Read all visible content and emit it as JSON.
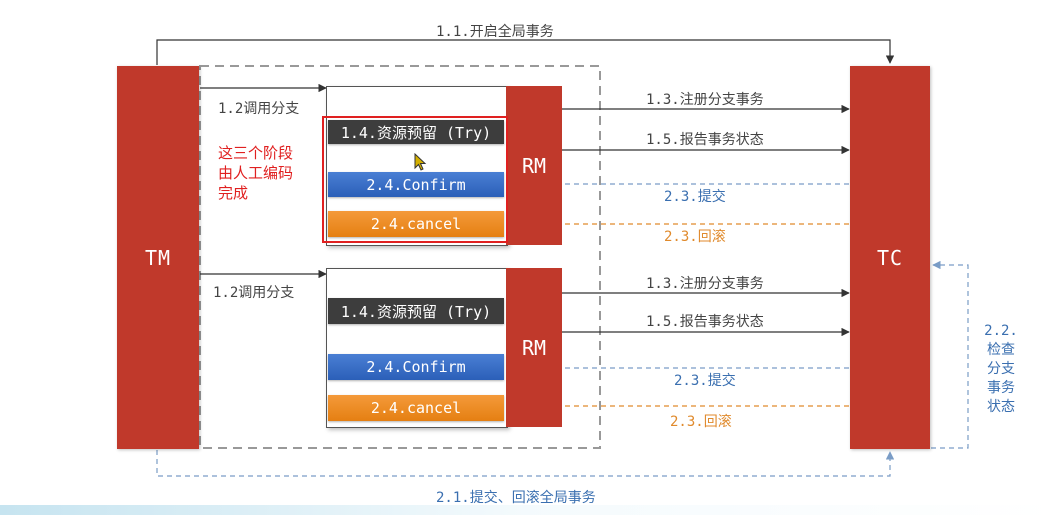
{
  "tm": {
    "label": "TM"
  },
  "tc": {
    "label": "TC"
  },
  "rm1": {
    "label": "RM",
    "try_label": "1.4.资源预留 (Try)",
    "confirm_label": "2.4.Confirm",
    "cancel_label": "2.4.cancel",
    "call_label": "1.2调用分支",
    "register_label": "1.3.注册分支事务",
    "report_label": "1.5.报告事务状态",
    "commit_label": "2.3.提交",
    "rollback_label": "2.3.回滚"
  },
  "rm2": {
    "label": "RM",
    "try_label": "1.4.资源预留 (Try)",
    "confirm_label": "2.4.Confirm",
    "cancel_label": "2.4.cancel",
    "call_label": "1.2调用分支",
    "register_label": "1.3.注册分支事务",
    "report_label": "1.5.报告事务状态",
    "commit_label": "2.3.提交",
    "rollback_label": "2.3.回滚"
  },
  "global_start_label": "1.1.开启全局事务",
  "global_end_label": "2.1.提交、回滚全局事务",
  "check_lines": [
    "2.2.",
    "检查",
    "分支",
    "事务",
    "状态"
  ],
  "note_lines": [
    "这三个阶段",
    "由人工编码",
    "完成"
  ],
  "colors": {
    "red": "#c0392b",
    "blue": "#3a6fb0",
    "orange": "#e08a2c",
    "note": "#e02020"
  }
}
